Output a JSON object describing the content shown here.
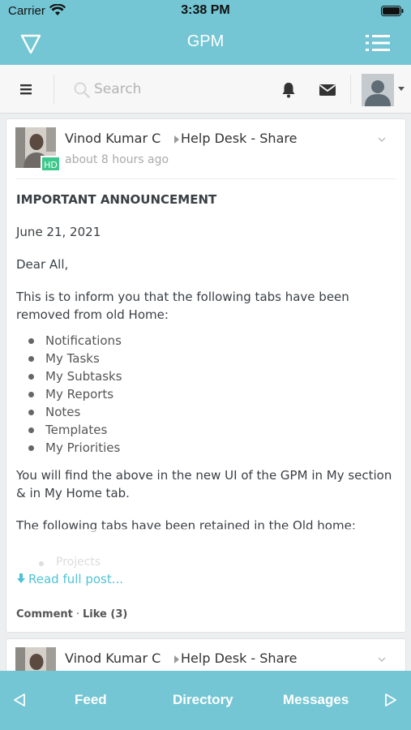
{
  "status_bar": {
    "carrier": "Carrier",
    "time": "3:38 PM"
  },
  "app": {
    "title": "GPM"
  },
  "toolbar": {
    "search_placeholder": "Search"
  },
  "posts": [
    {
      "author": "Vinod Kumar C",
      "group": "Help Desk - Share",
      "time": "about 8 hours ago",
      "badge": "HD",
      "heading": "IMPORTANT ANNOUNCEMENT",
      "date": "June 21, 2021",
      "greeting": "Dear All,",
      "intro": "This is to inform you that the following tabs have been removed from old Home:",
      "removed_tabs": [
        "Notifications",
        "My Tasks",
        "My Subtasks",
        "My Reports",
        "Notes",
        "Templates",
        "My Priorities"
      ],
      "para2": "You will find the above in the new UI of the GPM in My section & in My Home tab.",
      "para3": "The following tabs have been retained in the Old home:",
      "retained_first": "Projects",
      "read_more": "Read full post...",
      "comment_label": "Comment",
      "like_label": "Like (3)"
    },
    {
      "author": "Vinod Kumar C",
      "group": "Help Desk - Share"
    }
  ],
  "tab_bar": {
    "feed": "Feed",
    "directory": "Directory",
    "messages": "Messages"
  },
  "colors": {
    "brand": "#74c6d4",
    "badge": "#3cc88c",
    "link": "#4fc3d6"
  }
}
